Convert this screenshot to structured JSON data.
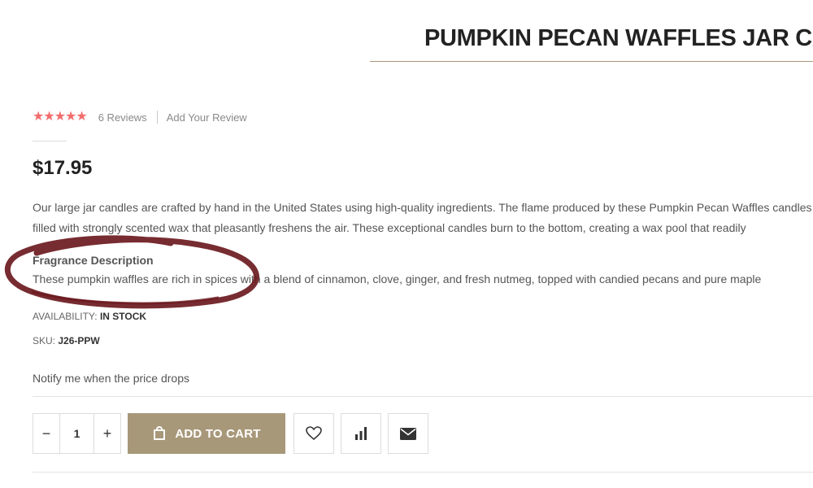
{
  "product": {
    "title": "PUMPKIN PECAN WAFFLES JAR CANDLE",
    "price": "$17.95",
    "rating": {
      "stars": 5,
      "reviews_label": "6  Reviews",
      "add_review_label": "Add Your Review",
      "star_color": "#f26d6d"
    },
    "description_lines": [
      "Our large jar candles are crafted by hand in the United States using high-quality ingredients. The flame produced by these Pumpkin Pecan Waffles candles",
      "filled with strongly scented wax that pleasantly freshens the air. These exceptional candles burn to the bottom, creating a wax pool that readily"
    ],
    "fragrance": {
      "heading": "Fragrance Description",
      "text": "These pumpkin waffles are rich in spices with a blend of cinnamon, clove, ginger, and fresh nutmeg, topped with candied pecans and pure maple"
    },
    "availability": {
      "label": "AVAILABILITY:",
      "value": "IN STOCK"
    },
    "sku": {
      "label": "SKU:",
      "value": "J26-PPW"
    },
    "notify_label": "Notify me when the price drops"
  },
  "cart": {
    "minus_label": "−",
    "quantity": "1",
    "plus_label": "+",
    "add_to_cart_label": "ADD TO CART"
  },
  "icons": {
    "cart": "shopping-bag-icon",
    "wishlist": "heart-icon",
    "compare": "bar-chart-icon",
    "email": "envelope-icon"
  },
  "colors": {
    "accent": "#a8987a",
    "annotation_circle": "#6b1a1f"
  }
}
